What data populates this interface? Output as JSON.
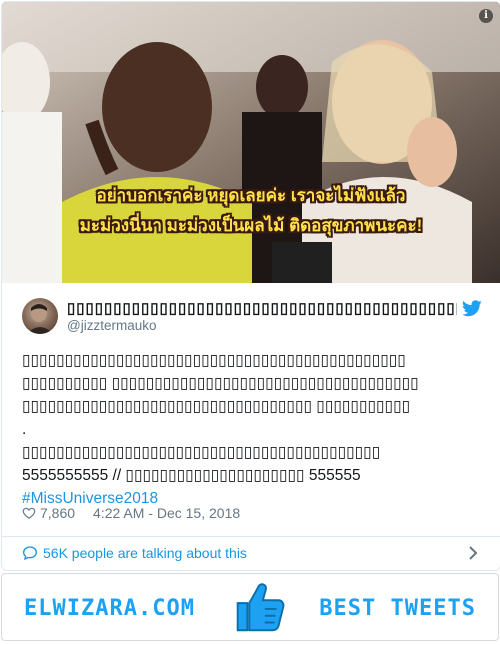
{
  "media": {
    "subtitle_line1": "อย่าบอกเราค่ะ หยุดเลยค่ะ เราจะไม่ฟังแล้ว",
    "subtitle_line2": "มะม่วงนี่นา มะม่วงเป็นผลไม้ ติดอสุขภาพนะคะ!",
    "info_label": "i"
  },
  "tweet": {
    "display_name": "▯▯▯▯▯▯▯▯▯▯▯▯▯▯▯▯▯▯▯▯▯▯▯▯▯▯▯▯▯▯▯▯▯▯▯▯▯▯▯▯▯▯▯▯",
    "handle": "@jizztermauko",
    "body_line1": "▯▯▯▯▯▯▯▯▯▯▯▯▯▯▯▯▯▯▯▯▯▯▯▯▯▯▯▯▯▯▯▯▯▯▯▯▯▯▯▯▯▯▯▯▯",
    "body_line2": "▯▯▯▯▯▯▯▯▯▯ ▯▯▯▯▯▯▯▯▯▯▯▯▯▯▯▯▯▯▯▯▯▯▯▯▯▯▯▯▯▯▯▯▯▯▯▯",
    "body_line3": "▯▯▯▯▯▯▯▯▯▯▯▯▯▯▯▯▯▯▯▯▯▯▯▯▯▯▯▯▯▯▯▯▯▯ ▯▯▯▯▯▯▯▯▯▯▯",
    "body_line4": ".",
    "body_line5": "▯▯▯▯▯▯▯▯▯▯▯▯▯▯▯▯▯▯▯▯▯▯▯▯▯▯▯▯▯▯▯▯▯▯▯▯▯▯▯▯▯▯",
    "body_line6": "5555555555 // ▯▯▯▯▯▯▯▯▯▯▯▯▯▯▯▯▯▯▯▯▯ 555555",
    "hashtag": "#MissUniverse2018",
    "likes": "7,860",
    "timestamp": "4:22 AM - Dec 15, 2018",
    "talking": "56K people are talking about this"
  },
  "banner": {
    "brand": "ELWIZARA.COM",
    "tagline": "BEST TWEETS"
  },
  "colors": {
    "twitter_blue": "#1da1f2",
    "link_blue": "#1b95e0",
    "muted": "#657786",
    "subtitle_yellow": "#ffe14a"
  }
}
